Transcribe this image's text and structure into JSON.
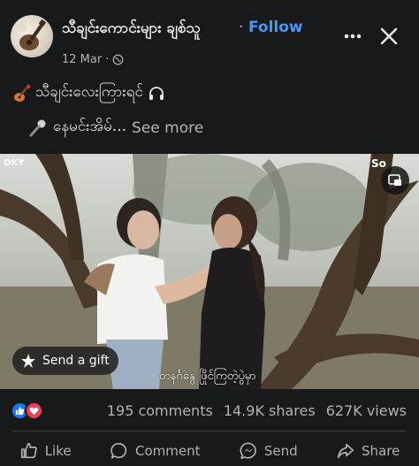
{
  "post": {
    "page_name": "သီချင်းကောင်းများ ချစ်သူ",
    "separator": "·",
    "follow_label": "Follow",
    "date": "12 Mar",
    "meta_separator": "·",
    "caption_line1": "သီချင်းလေးကြားရင်",
    "caption_line2": "နေမင်းအိမ်...",
    "see_more": "See more"
  },
  "video": {
    "logo_left": "OKY",
    "logo_right": "So",
    "gift_label": "Send a gift",
    "subtitle": "တနင်္ဂနွေ ဖြိုင်ကြတဲ့ပွဲမှာ"
  },
  "stats": {
    "comments": "195 comments",
    "shares": "14.9K shares",
    "views": "627K views"
  },
  "actions": {
    "like": "Like",
    "comment": "Comment",
    "send": "Send",
    "share": "Share"
  },
  "icons": {
    "more": "more-horizontal-icon",
    "close": "close-icon",
    "globe": "globe-icon",
    "guitar": "guitar-icon",
    "headphones": "headphones-icon",
    "microphone": "microphone-icon",
    "pip": "picture-in-picture-icon",
    "gift": "gift-icon",
    "like_reaction": "like-reaction-icon",
    "love_reaction": "love-reaction-icon"
  },
  "colors": {
    "background": "#18191a",
    "accent": "#4599ff",
    "text_primary": "#e4e6eb",
    "text_secondary": "#b0b3b8",
    "like_blue": "#1877f2",
    "love_red": "#f33e58"
  }
}
